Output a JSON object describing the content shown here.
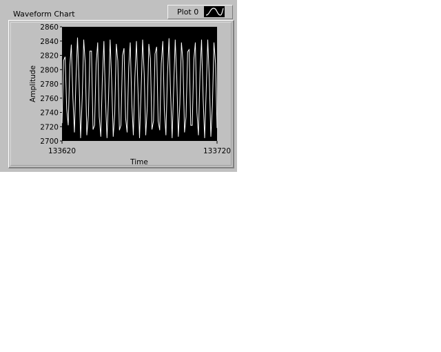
{
  "panel": {
    "title": "Waveform Chart",
    "legend_label": "Plot 0",
    "legend_icon": "line-plot-icon"
  },
  "colors": {
    "panel_bg": "#c0c0c0",
    "plot_bg": "#000000",
    "trace": "#ffffff"
  },
  "chart_data": {
    "type": "line",
    "title": "",
    "xlabel": "Time",
    "ylabel": "Amplitude",
    "xlim": [
      133620,
      133720
    ],
    "ylim": [
      2700,
      2860
    ],
    "x_ticks": [
      "133620",
      "133720"
    ],
    "y_ticks": [
      "2700",
      "2720",
      "2740",
      "2760",
      "2780",
      "2800",
      "2820",
      "2840",
      "2860"
    ],
    "grid": false,
    "legend": "top-right",
    "series": [
      {
        "name": "Plot 0",
        "x_start": 133620,
        "x_step": 1,
        "values": [
          2725,
          2813,
          2818,
          2745,
          2722,
          2804,
          2835,
          2760,
          2712,
          2788,
          2845,
          2782,
          2704,
          2760,
          2842,
          2808,
          2708,
          2736,
          2826,
          2826,
          2716,
          2722,
          2808,
          2838,
          2734,
          2706,
          2786,
          2840,
          2760,
          2704,
          2760,
          2842,
          2786,
          2706,
          2738,
          2836,
          2812,
          2715,
          2722,
          2820,
          2830,
          2732,
          2712,
          2803,
          2838,
          2752,
          2708,
          2790,
          2840,
          2770,
          2704,
          2770,
          2842,
          2794,
          2708,
          2748,
          2836,
          2815,
          2716,
          2728,
          2822,
          2832,
          2728,
          2715,
          2808,
          2840,
          2744,
          2708,
          2792,
          2844,
          2768,
          2704,
          2772,
          2842,
          2790,
          2706,
          2752,
          2838,
          2812,
          2712,
          2734,
          2825,
          2828,
          2722,
          2722,
          2814,
          2838,
          2740,
          2708,
          2796,
          2842,
          2760,
          2704,
          2772,
          2842,
          2786,
          2706,
          2750,
          2838,
          2808,
          2718
        ]
      }
    ]
  }
}
